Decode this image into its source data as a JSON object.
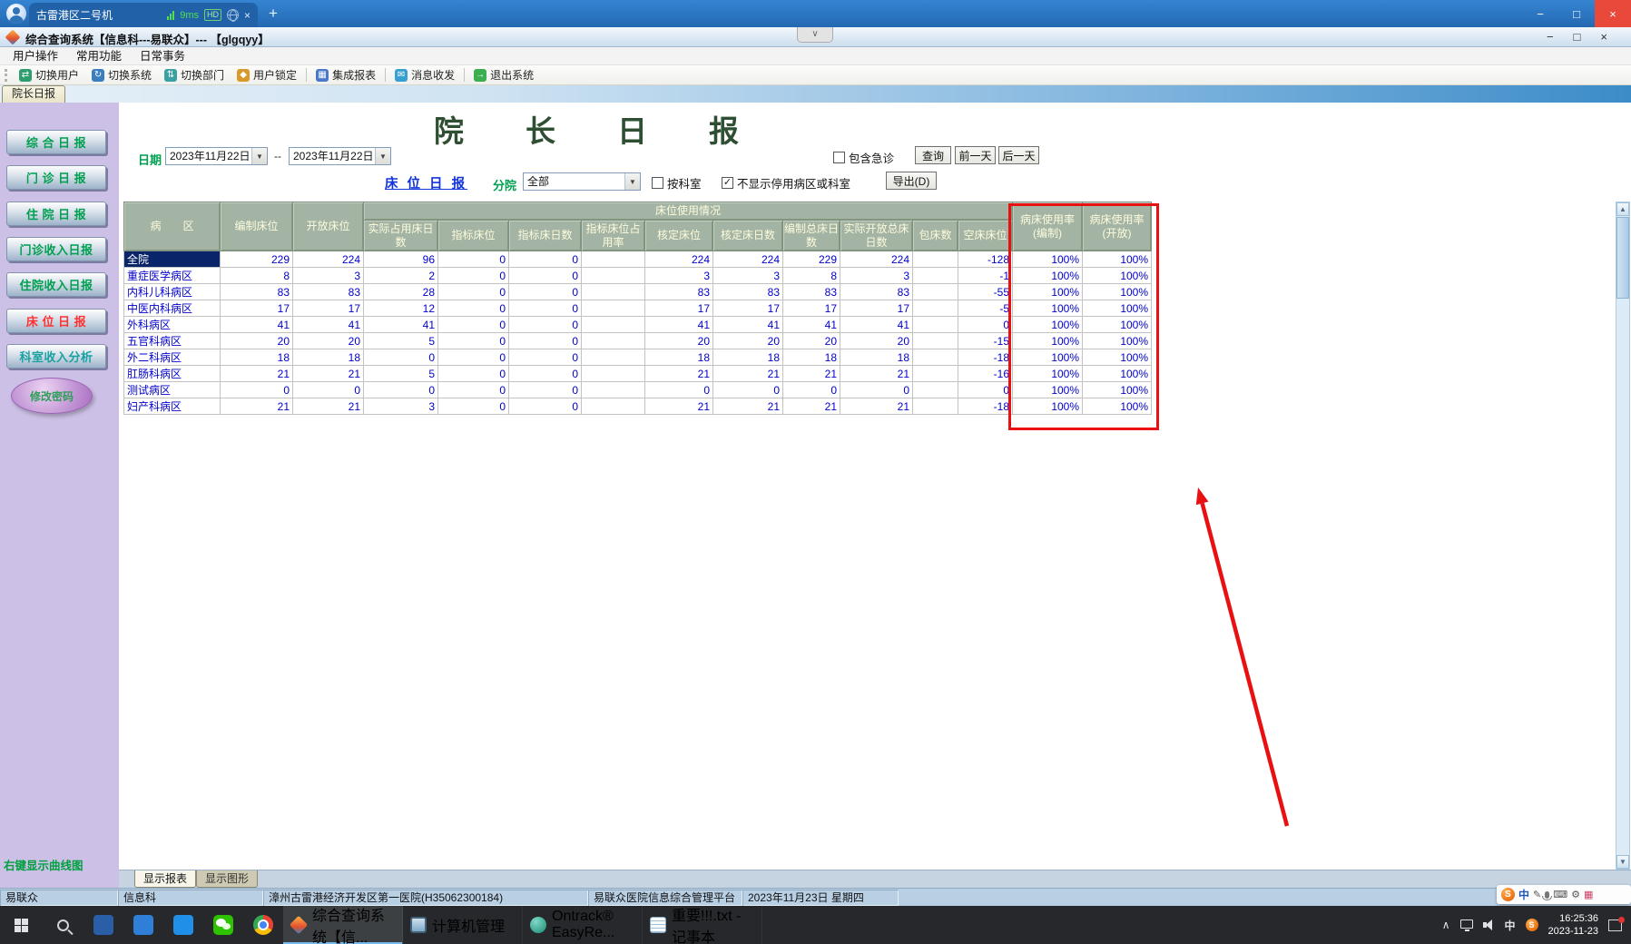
{
  "icons": {
    "minimize": "−",
    "maximize": "□",
    "close": "×",
    "dropdown_arrow": "▼",
    "chevron_down": "∨",
    "chevron_up": "∧",
    "check": "✓",
    "scroll_up": "▲",
    "scroll_down": "▼",
    "new_tab_plus": "+",
    "pen": "✎",
    "keyboard": "⌨",
    "gear": "⚙",
    "grid": "▦"
  },
  "colors": {
    "annotation_red": "#e81010",
    "sidebar_button_green": "#00a050",
    "sidebar_active_red": "#ff3232",
    "table_text_blue": "#0000cd",
    "table_header_bg": "#a3b4a4",
    "selected_cell_bg": "#0a246a",
    "remote_bar_blue": "#2b78c8",
    "taskbar_dark": "#26282b"
  },
  "remote_bar": {
    "tab_title": "古雷港区二号机",
    "latency": "9ms",
    "hd_badge": "HD"
  },
  "titlebar": {
    "title": "综合查询系统【信息科---易联众】--- 【glgqyy】"
  },
  "menubar": {
    "items": [
      "用户操作",
      "常用功能",
      "日常事务"
    ]
  },
  "toolbar": {
    "items": [
      {
        "label": "切换用户",
        "icon": "switch-user-icon",
        "glyph": "⇄",
        "color": "#2e9e6e",
        "sep_after": false
      },
      {
        "label": "切换系统",
        "icon": "switch-system-icon",
        "glyph": "↻",
        "color": "#3a7ec0",
        "sep_after": false
      },
      {
        "label": "切换部门",
        "icon": "switch-department-icon",
        "glyph": "⇅",
        "color": "#3aa0a0",
        "sep_after": false
      },
      {
        "label": "用户锁定",
        "icon": "user-lock-icon",
        "glyph": "◆",
        "color": "#d89a2a",
        "sep_after": true
      },
      {
        "label": "集成报表",
        "icon": "integrated-reports-icon",
        "glyph": "▦",
        "color": "#4a78c8",
        "sep_after": true
      },
      {
        "label": "消息收发",
        "icon": "messages-icon",
        "glyph": "✉",
        "color": "#38a0d0",
        "sep_after": true
      },
      {
        "label": "退出系统",
        "icon": "exit-system-icon",
        "glyph": "→",
        "color": "#3cae50",
        "sep_after": false
      }
    ]
  },
  "doc_tab": "院长日报",
  "sidebar": {
    "buttons": [
      {
        "label": "综 合 日 报"
      },
      {
        "label": "门 诊 日 报"
      },
      {
        "label": "住 院 日 报"
      },
      {
        "label": "门诊收入日报"
      },
      {
        "label": "住院收入日报"
      },
      {
        "label": "床 位 日 报",
        "active": true
      },
      {
        "label": "科室收入分析",
        "variant": "teal"
      }
    ],
    "oval_button": "修改密码",
    "hint": "右键显示曲线图"
  },
  "report": {
    "title": "院长日报",
    "date_label": "日期",
    "date_from": "2023年11月22日",
    "range_separator": "--",
    "date_to": "2023年11月22日",
    "include_emergency_label": "包含急诊",
    "query_button": "查询",
    "prev_day_button": "前一天",
    "next_day_button": "后一天",
    "section_link": "床 位 日 报",
    "branch_label": "分院",
    "branch_value": "全部",
    "by_dept_label": "按科室",
    "hide_disabled_label": "不显示停用病区或科室",
    "export_button": "导出(D)"
  },
  "table": {
    "group_header": "床位使用情况",
    "columns": [
      "病　　区",
      "编制床位",
      "开放床位",
      "实际占用床日数",
      "指标床位",
      "指标床日数",
      "指标床位占用率",
      "核定床位",
      "核定床日数",
      "编制总床日数",
      "实际开放总床日数",
      "包床数",
      "空床床位",
      "病床使用率(编制)",
      "病床使用率(开放)"
    ],
    "rows": [
      {
        "cells": [
          "全院",
          "229",
          "224",
          "96",
          "0",
          "0",
          "",
          "224",
          "224",
          "229",
          "224",
          "",
          "-128",
          "100%",
          "100%"
        ],
        "selected": true
      },
      {
        "cells": [
          "重症医学病区",
          "8",
          "3",
          "2",
          "0",
          "0",
          "",
          "3",
          "3",
          "8",
          "3",
          "",
          "-1",
          "100%",
          "100%"
        ]
      },
      {
        "cells": [
          "内科儿科病区",
          "83",
          "83",
          "28",
          "0",
          "0",
          "",
          "83",
          "83",
          "83",
          "83",
          "",
          "-55",
          "100%",
          "100%"
        ]
      },
      {
        "cells": [
          "中医内科病区",
          "17",
          "17",
          "12",
          "0",
          "0",
          "",
          "17",
          "17",
          "17",
          "17",
          "",
          "-5",
          "100%",
          "100%"
        ]
      },
      {
        "cells": [
          "外科病区",
          "41",
          "41",
          "41",
          "0",
          "0",
          "",
          "41",
          "41",
          "41",
          "41",
          "",
          "0",
          "100%",
          "100%"
        ]
      },
      {
        "cells": [
          "五官科病区",
          "20",
          "20",
          "5",
          "0",
          "0",
          "",
          "20",
          "20",
          "20",
          "20",
          "",
          "-15",
          "100%",
          "100%"
        ]
      },
      {
        "cells": [
          "外二科病区",
          "18",
          "18",
          "0",
          "0",
          "0",
          "",
          "18",
          "18",
          "18",
          "18",
          "",
          "-18",
          "100%",
          "100%"
        ]
      },
      {
        "cells": [
          "肛肠科病区",
          "21",
          "21",
          "5",
          "0",
          "0",
          "",
          "21",
          "21",
          "21",
          "21",
          "",
          "-16",
          "100%",
          "100%"
        ]
      },
      {
        "cells": [
          "测试病区",
          "0",
          "0",
          "0",
          "0",
          "0",
          "",
          "0",
          "0",
          "0",
          "0",
          "",
          "0",
          "100%",
          "100%"
        ]
      },
      {
        "cells": [
          "妇产科病区",
          "21",
          "21",
          "3",
          "0",
          "0",
          "",
          "21",
          "21",
          "21",
          "21",
          "",
          "-18",
          "100%",
          "100%"
        ]
      }
    ]
  },
  "bottom_tabs": {
    "report": "显示报表",
    "graphic": "显示图形"
  },
  "statusbar": {
    "segments": [
      "易联众",
      "信息科",
      "漳州古雷港经济开发区第一医院(H35062300184)",
      "易联众医院信息综合管理平台",
      "2023年11月23日 星期四"
    ]
  },
  "ime_bar": {
    "logo": "S",
    "mode": "中"
  },
  "taskbar": {
    "pinned": [
      {
        "icon": "files-app-icon",
        "color": "#2a5fa8"
      },
      {
        "icon": "video-app-icon",
        "color": "#2f7fd8"
      },
      {
        "icon": "meeting-app-icon",
        "color": "#1f8fe8"
      },
      {
        "icon": "wechat-icon",
        "color": "#2dc100"
      },
      {
        "icon": "chrome-icon",
        "color": ""
      }
    ],
    "apps": [
      {
        "label": "综合查询系统【信...",
        "icon": "query-system-icon",
        "active": true
      },
      {
        "label": "计算机管理",
        "icon": "computer-management-icon"
      },
      {
        "label": "Ontrack® EasyRe...",
        "icon": "ontrack-easyrecovery-icon"
      },
      {
        "label": "重要!!!.txt - 记事本",
        "icon": "notepad-icon"
      }
    ],
    "tray": {
      "ime_mode": "中",
      "time": "16:25:36",
      "date": "2023-11-23"
    }
  }
}
